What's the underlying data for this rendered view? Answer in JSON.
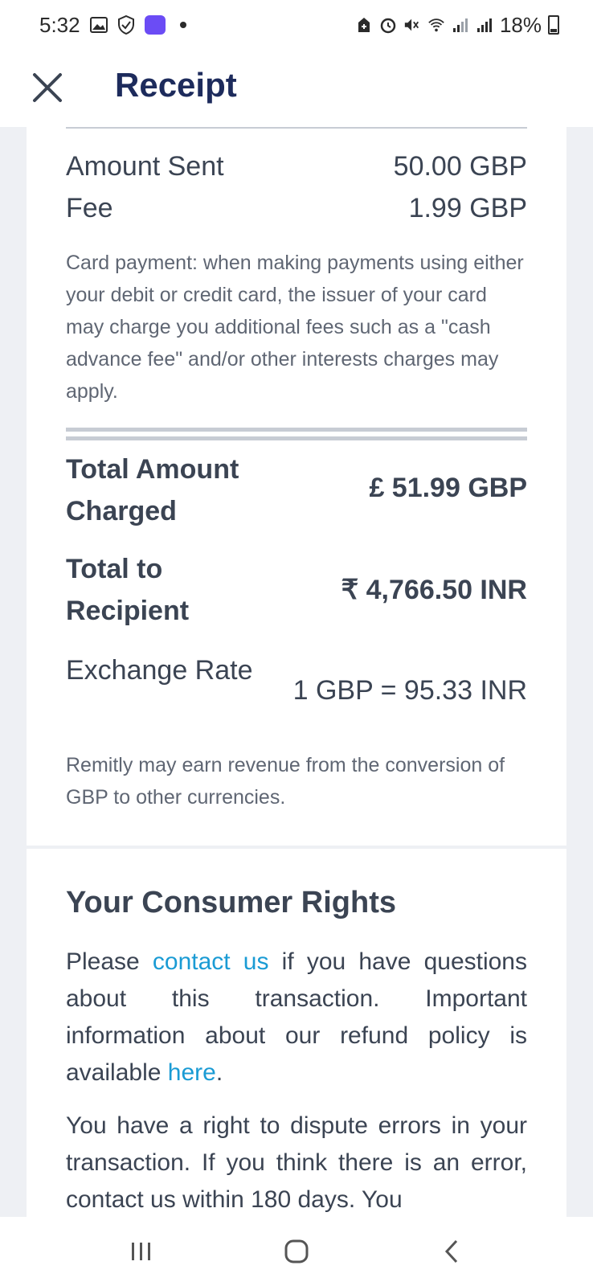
{
  "status_bar": {
    "time": "5:32",
    "battery": "18%",
    "icons": [
      "gallery-icon",
      "shield-icon",
      "app-badge-icon",
      "notification-dot-icon",
      "battery-saver-icon",
      "alarm-icon",
      "mute-icon",
      "wifi-icon",
      "signal-icon",
      "signal-icon",
      "battery-icon"
    ]
  },
  "header": {
    "title": "Receipt",
    "close_icon": "close-icon"
  },
  "receipt": {
    "amount_sent_label": "Amount Sent",
    "amount_sent_value": "50.00 GBP",
    "fee_label": "Fee",
    "fee_value": "1.99 GBP",
    "card_note": "Card payment: when making payments using either your debit or credit card, the issuer of your card may charge you additional fees such as a \"cash advance fee\" and/or other interests charges may apply.",
    "total_charged_label": "Total Amount Charged",
    "total_charged_value": "£ 51.99 GBP",
    "total_recipient_label": "Total to Recipient",
    "total_recipient_value": "₹ 4,766.50 INR",
    "exchange_rate_label": "Exchange Rate",
    "exchange_rate_value": "1 GBP = 95.33 INR",
    "revenue_note": "Remitly may earn revenue from the conversion of GBP to other currencies."
  },
  "consumer_rights": {
    "heading": "Your Consumer Rights",
    "para1_pre": "Please ",
    "para1_link": "contact us",
    "para1_mid": " if you have questions about this transaction. Important information about our refund policy is available ",
    "para1_link2": "here",
    "para1_post": ".",
    "para2": "You have a right to dispute errors in your transaction. If you think there is an error, contact us within 180 days. You"
  },
  "nav_bar": {
    "recents_icon": "recents-icon",
    "home_icon": "home-icon",
    "back_icon": "back-icon"
  },
  "colors": {
    "title": "#1d2b5c",
    "text": "#3b4453",
    "link": "#1a9bd4",
    "background": "#eef0f4"
  }
}
